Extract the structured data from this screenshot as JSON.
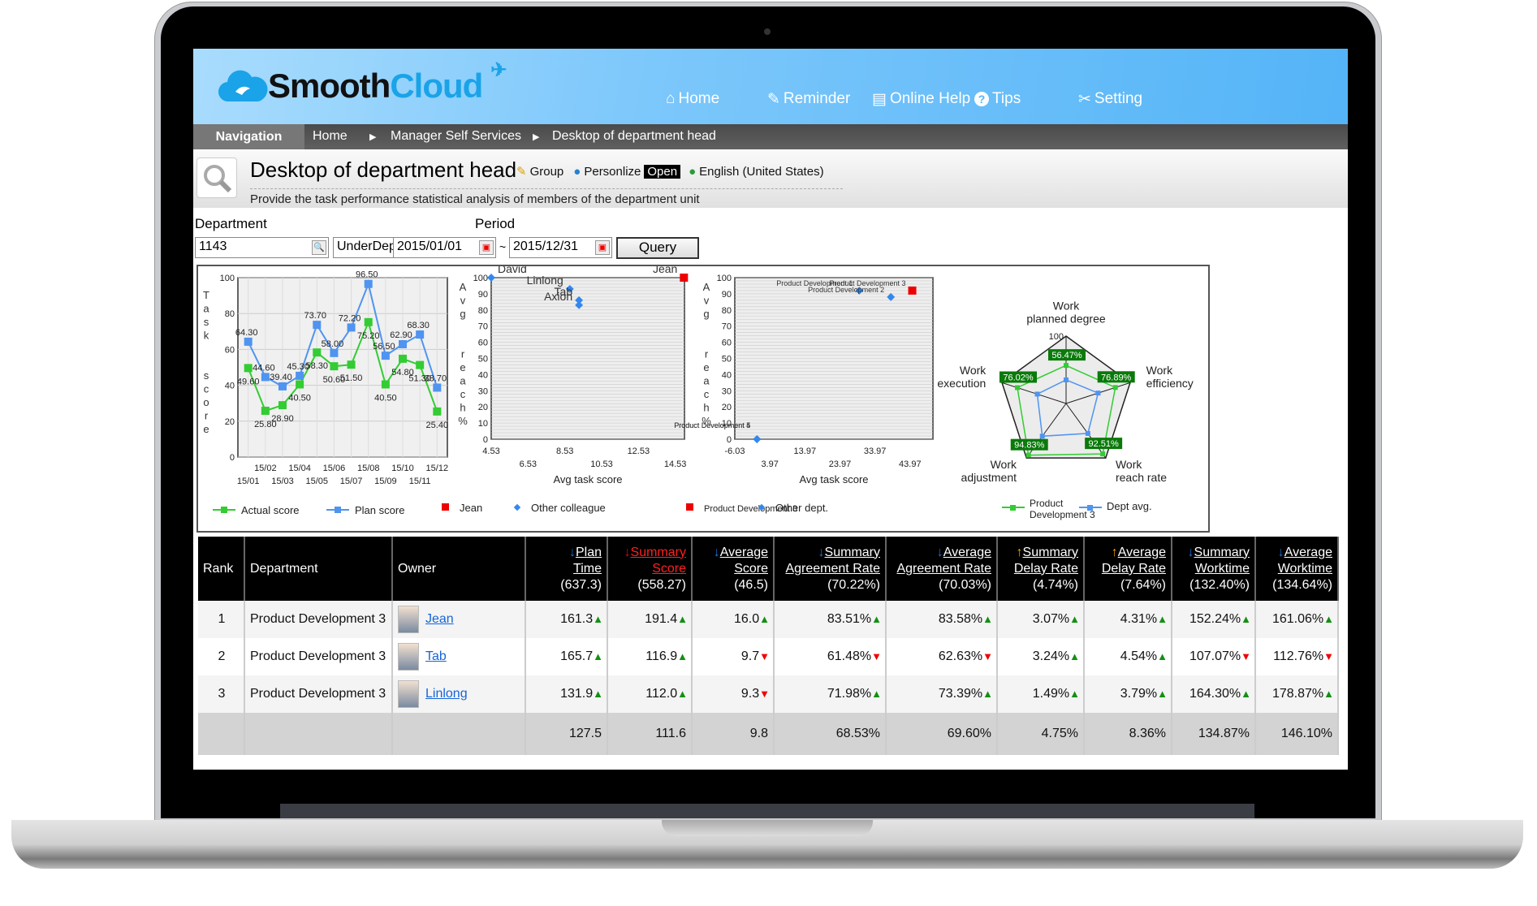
{
  "app": {
    "brand_a": "Smooth",
    "brand_b": "Cloud"
  },
  "topnav": [
    {
      "label": "Home",
      "icon": "home-icon"
    },
    {
      "label": "Reminder",
      "icon": "pin-icon"
    },
    {
      "label": "Online Help",
      "icon": "book-icon"
    },
    {
      "label": "Tips",
      "icon": "question-icon"
    },
    {
      "label": "Setting",
      "icon": "wrench-icon"
    }
  ],
  "breadcrumb": {
    "nav": "Navigation",
    "items": [
      "Home",
      "Manager Self Services",
      "Desktop of department head"
    ]
  },
  "page": {
    "title": "Desktop of department head",
    "group": "Group",
    "personalize": "Personlize",
    "open": "Open",
    "language": "English (United States)",
    "subtitle": "Provide the task performance statistical analysis of members of the department unit"
  },
  "filters": {
    "department_label": "Department",
    "department_value": "1143",
    "scope_value": "UnderDepartn",
    "period_label": "Period",
    "from": "2015/01/01",
    "sep": "~",
    "to": "2015/12/31",
    "query": "Query"
  },
  "colors": {
    "actual": "#33cc33",
    "plan": "#4f94f0",
    "highlight": "#ee0000",
    "up": "#129012",
    "down": "#ee0000",
    "header": "#54b4f7"
  },
  "chart_data": [
    {
      "type": "line",
      "ylabel": "Task score",
      "ylim": [
        0,
        100
      ],
      "yticks": [
        0,
        20,
        40,
        60,
        80,
        100
      ],
      "grid": true,
      "categories": [
        "15/01",
        "15/02",
        "15/03",
        "15/04",
        "15/05",
        "15/06",
        "15/07",
        "15/08",
        "15/09",
        "15/10",
        "15/11",
        "15/12"
      ],
      "series": [
        {
          "name": "Actual score",
          "color": "#33cc33",
          "values": [
            49.6,
            25.8,
            28.9,
            40.5,
            58.3,
            50.6,
            51.5,
            75.2,
            40.5,
            54.8,
            51.3,
            25.4
          ]
        },
        {
          "name": "Plan score",
          "color": "#4f94f0",
          "values": [
            64.3,
            44.6,
            39.4,
            45.3,
            73.7,
            58.0,
            72.2,
            96.5,
            56.5,
            62.9,
            68.3,
            38.7
          ]
        }
      ]
    },
    {
      "type": "scatter",
      "xlabel": "Avg task score",
      "ylabel": "Avg reach %",
      "xlim": [
        4.53,
        15.03
      ],
      "ylim": [
        0,
        100
      ],
      "xticks": [
        "4.53",
        "6.53",
        "8.53",
        "10.53",
        "12.53",
        "14.53"
      ],
      "yticks": [
        0,
        10,
        20,
        30,
        40,
        50,
        60,
        70,
        80,
        90,
        100
      ],
      "grid": true,
      "series": [
        {
          "name": "Jean",
          "marker": "square",
          "color": "#ee0000",
          "points": [
            {
              "label": "Jean",
              "x": 15.0,
              "y": 100
            }
          ]
        },
        {
          "name": "Other colleague",
          "marker": "diamond",
          "color": "#3388ee",
          "points": [
            {
              "label": "David",
              "x": 4.53,
              "y": 100
            },
            {
              "label": "Linlong",
              "x": 8.8,
              "y": 93
            },
            {
              "label": "Tab",
              "x": 9.3,
              "y": 86
            },
            {
              "label": "Axion",
              "x": 9.3,
              "y": 83
            }
          ]
        }
      ]
    },
    {
      "type": "scatter",
      "xlabel": "Avg task score",
      "ylabel": "Avg reach %",
      "xlim": [
        -6.03,
        50.5
      ],
      "ylim": [
        0,
        100
      ],
      "xticks": [
        "-6.03",
        "3.97",
        "13.97",
        "23.97",
        "33.97",
        "43.97"
      ],
      "yticks": [
        0,
        10,
        20,
        30,
        40,
        50,
        60,
        70,
        80,
        90,
        100
      ],
      "grid": true,
      "series": [
        {
          "name": "Product Development 3",
          "marker": "square",
          "color": "#ee0000",
          "points": [
            {
              "label": "Product Development 3",
              "x": 44.6,
              "y": 92
            }
          ]
        },
        {
          "name": "Other dept.",
          "marker": "diamond",
          "color": "#3388ee",
          "points": [
            {
              "label": "Product Development 1",
              "x": 29.5,
              "y": 92
            },
            {
              "label": "Product Development 2",
              "x": 38.5,
              "y": 88
            },
            {
              "label": "Product Development 4",
              "x": 0.3,
              "y": 0
            },
            {
              "label": "Product Development 5",
              "x": 0.3,
              "y": 0
            }
          ]
        }
      ]
    },
    {
      "type": "radar",
      "rlim": [
        0,
        100
      ],
      "rticks": [
        0,
        25,
        50,
        75,
        100
      ],
      "axes": [
        "Work planned degree",
        "Work efficiency",
        "Work reach rate",
        "Work adjustment",
        "Work execution"
      ],
      "series": [
        {
          "name": "Product Development 3",
          "color": "#33cc33",
          "values": [
            56.47,
            76.89,
            92.51,
            94.83,
            76.02
          ],
          "labels": [
            "56.47%",
            "76.89%",
            "92.51%",
            "94.83%",
            "76.02%"
          ]
        },
        {
          "name": "Dept avg.",
          "color": "#4f94f0",
          "values": [
            35,
            50,
            55,
            60,
            45
          ]
        }
      ]
    }
  ],
  "table": {
    "headers": [
      {
        "label": "Rank"
      },
      {
        "label": "Department"
      },
      {
        "label": "Owner"
      },
      {
        "l1": "Plan",
        "l2": "Time",
        "l3": "(637.3)",
        "arrow": "↓",
        "ac": "#1a73d9"
      },
      {
        "l1": "Summary",
        "l2": "Score",
        "l3": "(558.27)",
        "arrow": "↓",
        "ac": "#e00",
        "red": true
      },
      {
        "l1": "Average",
        "l2": "Score",
        "l3": "(46.5)",
        "arrow": "↓",
        "ac": "#1a73d9"
      },
      {
        "l1": "Summary",
        "l2": "Agreement Rate",
        "l3": "(70.22%)",
        "arrow": "↓",
        "ac": "#1a73d9"
      },
      {
        "l1": "Average",
        "l2": "Agreement Rate",
        "l3": "(70.03%)",
        "arrow": "↓",
        "ac": "#1a73d9"
      },
      {
        "l1": "Summary",
        "l2": "Delay Rate",
        "l3": "(4.74%)",
        "arrow": "↑",
        "ac": "#f0a000"
      },
      {
        "l1": "Average",
        "l2": "Delay Rate",
        "l3": "(7.64%)",
        "arrow": "↑",
        "ac": "#f0a000"
      },
      {
        "l1": "Summary",
        "l2": "Worktime",
        "l3": "(132.40%)",
        "arrow": "↓",
        "ac": "#1a73d9"
      },
      {
        "l1": "Average",
        "l2": "Worktime",
        "l3": "(134.64%)",
        "arrow": "↓",
        "ac": "#1a73d9"
      }
    ],
    "rows": [
      {
        "rank": "1",
        "dept": "Product Development 3",
        "owner": "Jean",
        "cells": [
          [
            "161.3",
            "up"
          ],
          [
            "191.4",
            "up"
          ],
          [
            "16.0",
            "up"
          ],
          [
            "83.51%",
            "up"
          ],
          [
            "83.58%",
            "up"
          ],
          [
            "3.07%",
            "up"
          ],
          [
            "4.31%",
            "up"
          ],
          [
            "152.24%",
            "up"
          ],
          [
            "161.06%",
            "up"
          ]
        ]
      },
      {
        "rank": "2",
        "dept": "Product Development 3",
        "owner": "Tab",
        "cells": [
          [
            "165.7",
            "up"
          ],
          [
            "116.9",
            "up"
          ],
          [
            "9.7",
            "down"
          ],
          [
            "61.48%",
            "down"
          ],
          [
            "62.63%",
            "down"
          ],
          [
            "3.24%",
            "up"
          ],
          [
            "4.54%",
            "up"
          ],
          [
            "107.07%",
            "down"
          ],
          [
            "112.76%",
            "down"
          ]
        ]
      },
      {
        "rank": "3",
        "dept": "Product Development 3",
        "owner": "Linlong",
        "cells": [
          [
            "131.9",
            "up"
          ],
          [
            "112.0",
            "up"
          ],
          [
            "9.3",
            "down"
          ],
          [
            "71.98%",
            "up"
          ],
          [
            "73.39%",
            "up"
          ],
          [
            "1.49%",
            "up"
          ],
          [
            "3.79%",
            "up"
          ],
          [
            "164.30%",
            "up"
          ],
          [
            "178.87%",
            "up"
          ]
        ]
      }
    ],
    "totals": [
      "127.5",
      "111.6",
      "9.8",
      "68.53%",
      "69.60%",
      "4.75%",
      "8.36%",
      "134.87%",
      "146.10%"
    ]
  }
}
